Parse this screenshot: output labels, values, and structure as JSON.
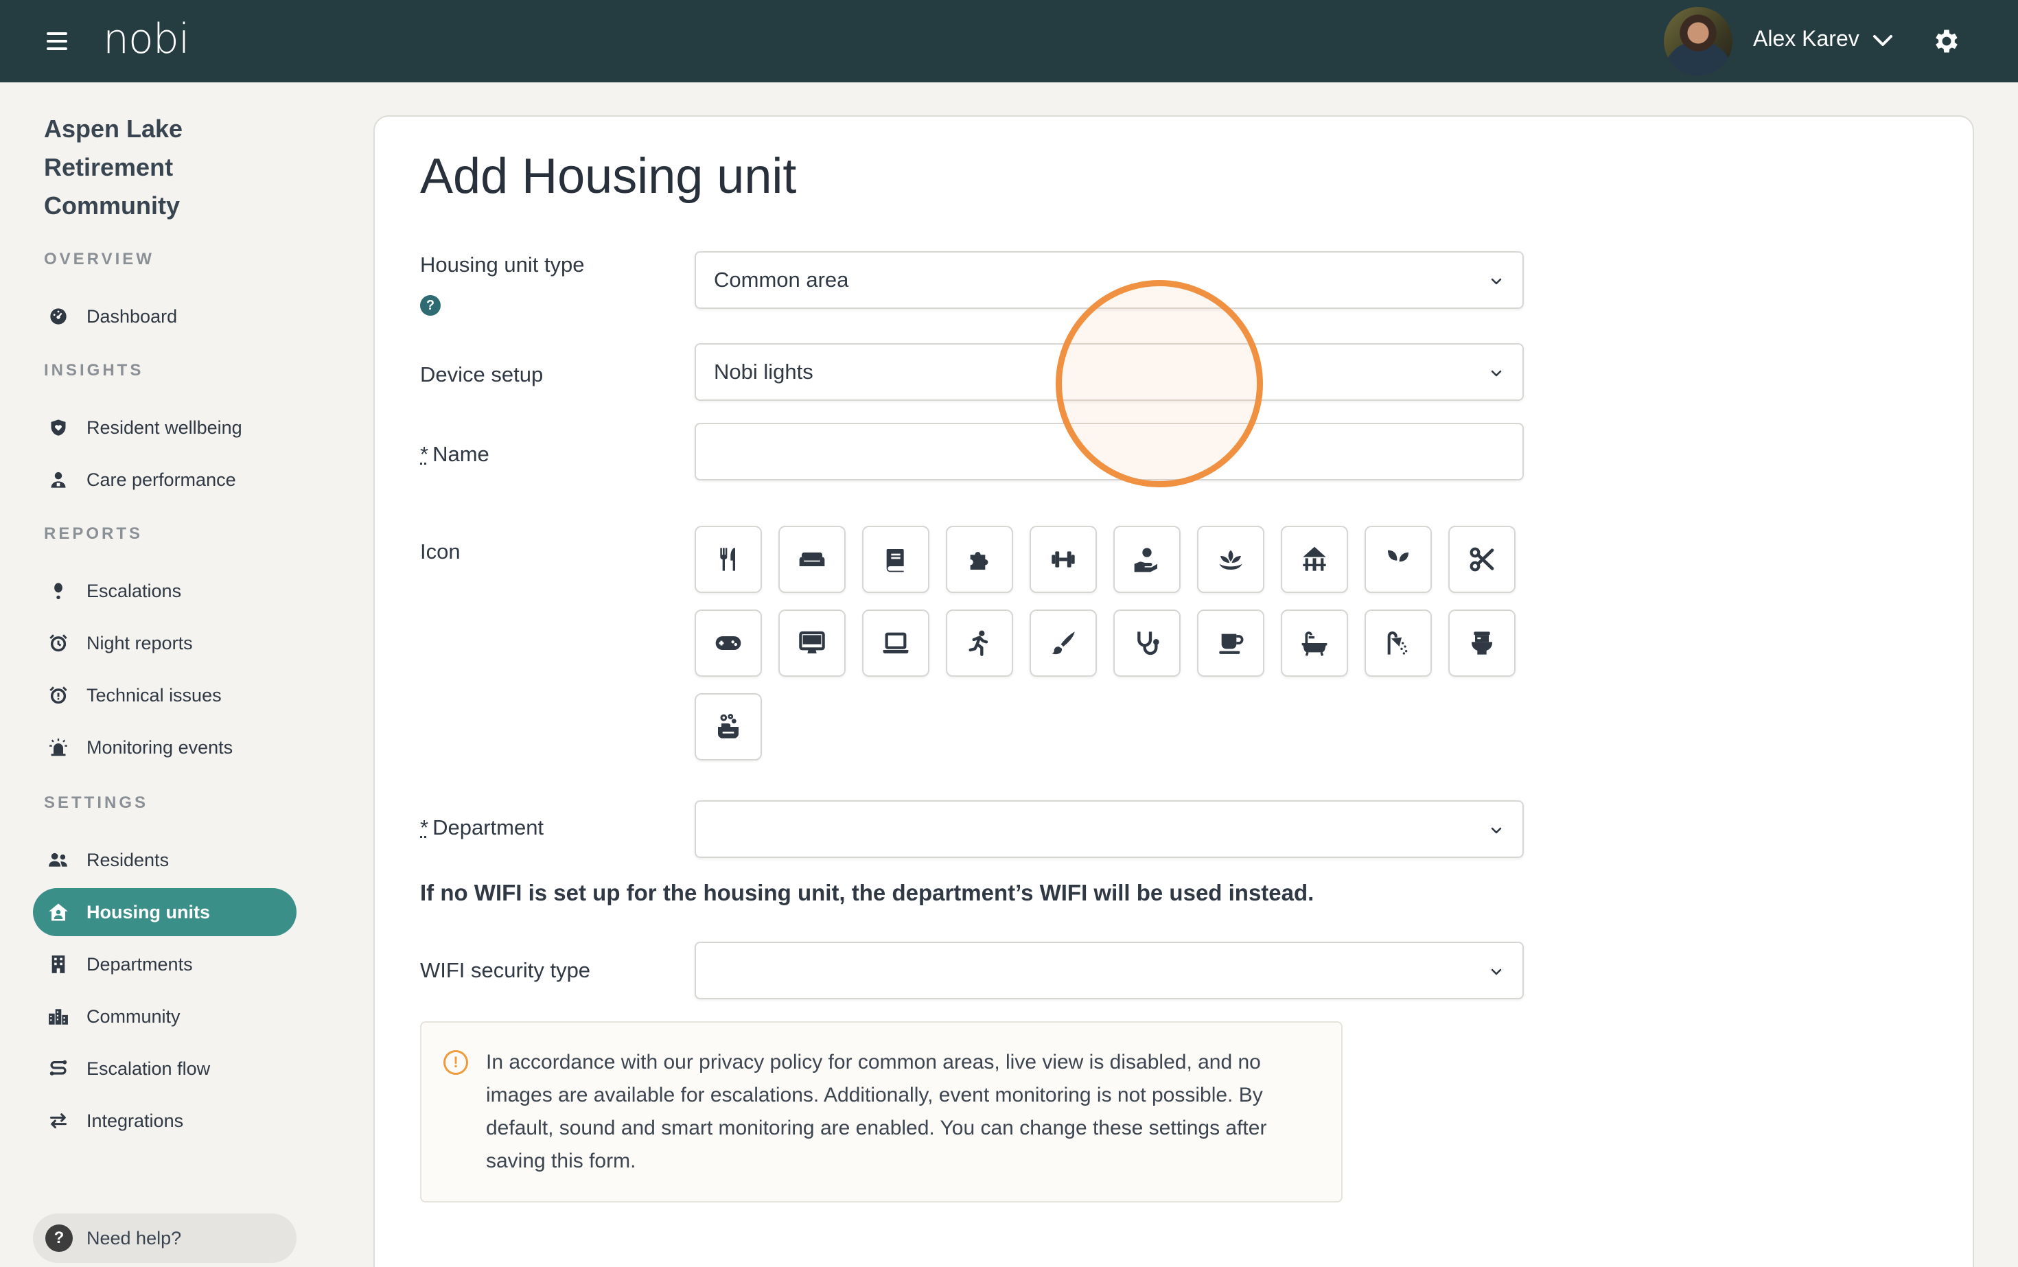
{
  "app": {
    "logo": "nobi"
  },
  "user": {
    "name": "Alex Karev"
  },
  "sidebar": {
    "org_name": "Aspen Lake Retirement Community",
    "sections": {
      "overview": "OVERVIEW",
      "insights": "INSIGHTS",
      "reports": "REPORTS",
      "settings": "SETTINGS"
    },
    "items": {
      "dashboard": "Dashboard",
      "resident_wellbeing": "Resident wellbeing",
      "care_performance": "Care performance",
      "escalations": "Escalations",
      "night_reports": "Night reports",
      "technical_issues": "Technical issues",
      "monitoring_events": "Monitoring events",
      "residents": "Residents",
      "housing_units": "Housing units",
      "departments": "Departments",
      "community": "Community",
      "escalation_flow": "Escalation flow",
      "integrations": "Integrations"
    },
    "active_item": "housing_units",
    "help": "Need help?",
    "colors": {
      "active_bg": "#3a8f88",
      "topbar_bg": "#253c41"
    }
  },
  "form": {
    "title": "Add Housing unit",
    "housing_unit_type": {
      "label": "Housing unit type",
      "help": "?",
      "value": "Common area"
    },
    "device_setup": {
      "label": "Device setup",
      "value": "Nobi lights"
    },
    "name": {
      "required_mark": "*",
      "label": "Name",
      "value": ""
    },
    "icon": {
      "label": "Icon",
      "options": [
        "utensils-icon",
        "sofa-icon",
        "book-icon",
        "puzzle-icon",
        "dumbbell-icon",
        "hand-care-icon",
        "lotus-icon",
        "gazebo-icon",
        "seedling-icon",
        "scissors-icon",
        "gamepad-icon",
        "desktop-icon",
        "laptop-icon",
        "running-icon",
        "paintbrush-icon",
        "stethoscope-icon",
        "coffee-icon",
        "bathtub-icon",
        "shower-icon",
        "toilet-icon",
        "soap-icon"
      ]
    },
    "department": {
      "required_mark": "*",
      "label": "Department",
      "value": ""
    },
    "wifi_note": "If no WIFI is set up for the housing unit, the department’s WIFI will be used instead.",
    "wifi_security": {
      "label": "WIFI security type",
      "value": ""
    },
    "notice": {
      "icon": "!",
      "text": "In accordance with our privacy policy for common areas, live view is disabled, and no images are available for escalations. Additionally, event monitoring is not possible. By default, sound and smart monitoring are enabled. You can change these settings after saving this form."
    },
    "highlight_color": "#ef9140"
  }
}
